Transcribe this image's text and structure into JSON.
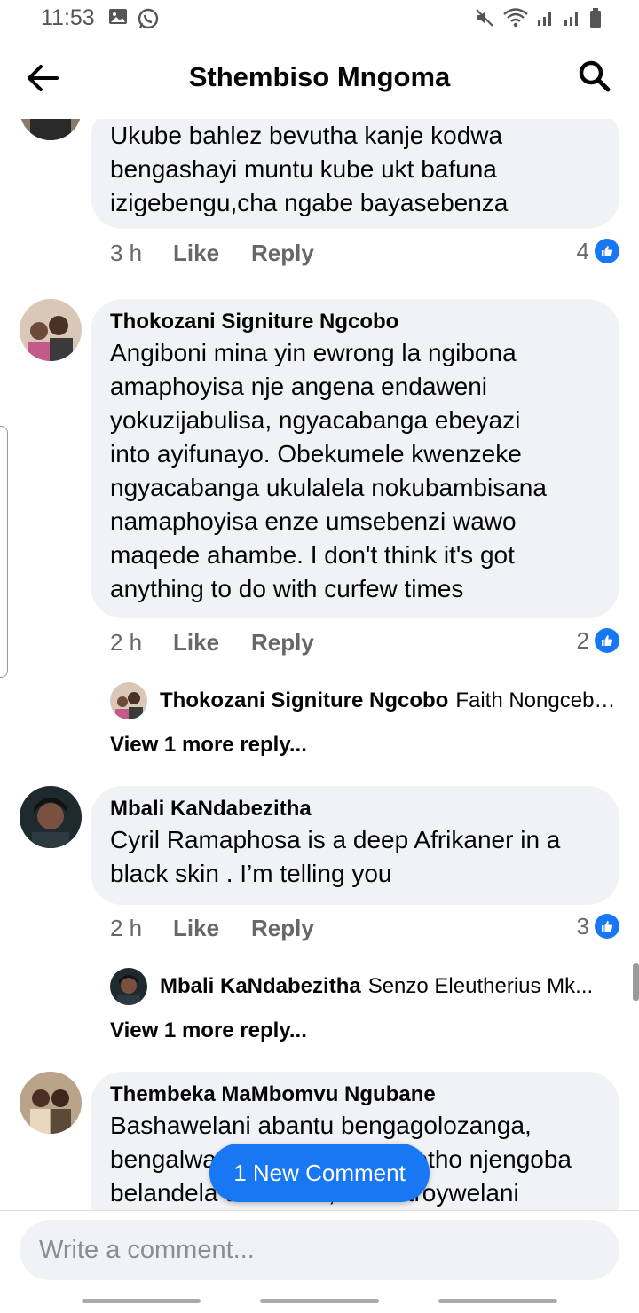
{
  "status_bar": {
    "time": "11:53",
    "left_icons": [
      "image-icon",
      "whatsapp-icon"
    ],
    "right_icons": [
      "mute-icon",
      "wifi-icon",
      "signal-icon",
      "signal-icon",
      "battery-icon"
    ]
  },
  "header": {
    "title": "Sthembiso Mngoma",
    "back_icon": "arrow-left-icon",
    "search_icon": "search-icon"
  },
  "comments": [
    {
      "text": "Ukube bahlez bevutha kanje kodwa\nbengashayi muntu kube ukt bafuna\nizigebengu,cha ngabe bayasebenza",
      "time": "3 h",
      "like_label": "Like",
      "reply_label": "Reply",
      "reaction_count": "4"
    },
    {
      "author": "Thokozani Signiture Ngcobo",
      "text": "Angiboni mina yin ewrong la ngibona\namaphoyisa nje angena endaweni\nyokuzijabulisa, ngyacabanga ebeyazi\ninto ayifunayo. Obekumele kwenzeke\nngyacabanga ukulalela nokubambisana\nnamaphoyisa enze umsebenzi wawo\nmaqede ahambe. I don't think it's got\nanything to do with curfew times",
      "time": "2 h",
      "like_label": "Like",
      "reply_label": "Reply",
      "reaction_count": "2",
      "reply_preview": {
        "author": "Thokozani Signiture Ngcobo",
        "text": "Faith Nongcebo..."
      },
      "view_more": "View 1 more reply..."
    },
    {
      "author": "Mbali KaNdabezitha",
      "text": "Cyril Ramaphosa is a deep Afrikaner in a\nblack skin . I’m telling you",
      "time": "2 h",
      "like_label": "Like",
      "reply_label": "Reply",
      "reaction_count": "3",
      "reply_preview": {
        "author": "Mbali KaNdabezitha",
        "text": "Senzo Eleutherius Mk..."
      },
      "view_more": "View 1 more reply..."
    },
    {
      "author": "Thembeka MaMbomvu Ngubane",
      "text": "Bashawelani abantu bengagolozanga,\nbengalwa, bengaphuli umthetho njengoba\nbelandela umthetho, zi destroywelani iyndawo"
    }
  ],
  "new_comment_pill": "1 New Comment",
  "composer": {
    "placeholder": "Write a comment..."
  },
  "colors": {
    "accent": "#1877f2",
    "bubble": "#f0f2f5",
    "muted_text": "#65676b"
  }
}
